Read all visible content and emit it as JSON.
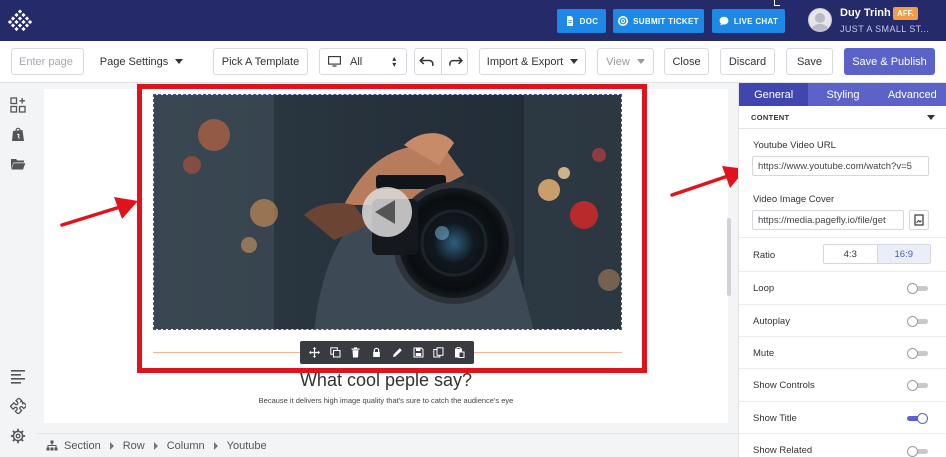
{
  "header": {
    "doc_label": "DOC",
    "ticket_label": "SUBMIT TICKET",
    "chat_label": "LIVE CHAT",
    "user_name": "Duy Trinh",
    "user_badge": "AFF.",
    "user_shop": "JUST A SMALL ST..."
  },
  "toolbar": {
    "page_title_placeholder": "Enter page ti",
    "page_settings": "Page Settings",
    "pick_template": "Pick A Template",
    "device": "All",
    "import_export": "Import & Export",
    "view": "View",
    "close": "Close",
    "discard": "Discard",
    "save": "Save",
    "save_publish": "Save & Publish"
  },
  "canvas": {
    "section_title": "What cool peple say?",
    "section_subtitle": "Because it delivers high image quality that's sure to catch the audience's eye"
  },
  "breadcrumb": [
    "Section",
    "Row",
    "Column",
    "Youtube"
  ],
  "panel": {
    "tabs": [
      "General",
      "Styling",
      "Advanced"
    ],
    "active_tab": "General",
    "content_heading": "CONTENT",
    "youtube_label": "Youtube Video URL",
    "youtube_value": "https://www.youtube.com/watch?v=5",
    "cover_label": "Video Image Cover",
    "cover_value": "https://media.pagefly.io/file/get",
    "ratio_label": "Ratio",
    "ratio_options": [
      "4:3",
      "16:9"
    ],
    "ratio_selected": "16:9",
    "toggles": [
      {
        "label": "Loop",
        "on": false
      },
      {
        "label": "Autoplay",
        "on": false
      },
      {
        "label": "Mute",
        "on": false
      },
      {
        "label": "Show Controls",
        "on": false
      },
      {
        "label": "Show Title",
        "on": true
      },
      {
        "label": "Show Related",
        "on": false
      }
    ]
  },
  "colors": {
    "header_bg": "#242a6a",
    "accent": "#5b63c9",
    "header_button": "#1e88e5",
    "highlight": "#e0131c"
  }
}
